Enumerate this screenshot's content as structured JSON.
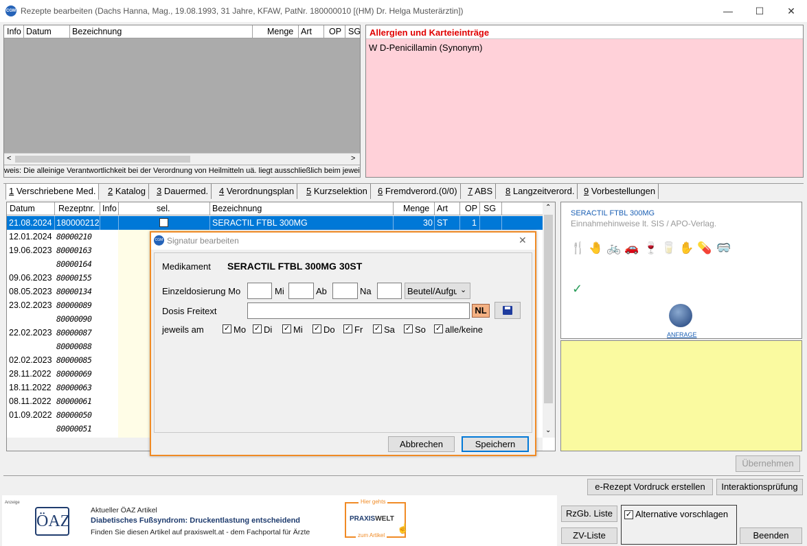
{
  "window": {
    "title": "Rezepte bearbeiten (Dachs Hanna, Mag., 19.08.1993, 31 Jahre, KFAW, PatNr. 180000010 [(HM) Dr. Helga Musterärztin])",
    "icon_text": "CGM",
    "min": "—",
    "max": "☐",
    "close": "✕"
  },
  "upper_table": {
    "headers": [
      "Info",
      "Datum",
      "Bezeichnung",
      "Menge",
      "Art",
      "OP",
      "SG"
    ],
    "hint": "weis: Die alleinige Verantwortlichkeit bei der Verordnung von Heilmitteln uä. liegt ausschließlich beim jeweiligen",
    "scroll_left": "<",
    "scroll_right": ">"
  },
  "allergy": {
    "title": "Allergien und Karteieinträge",
    "entry": "W D-Penicillamin (Synonym)"
  },
  "tabs": [
    {
      "num": "1",
      "label": " Verschriebene Med."
    },
    {
      "num": "2",
      "label": " Katalog"
    },
    {
      "num": "3",
      "label": " Dauermed."
    },
    {
      "num": "4",
      "label": " Verordnungsplan"
    },
    {
      "num": "5",
      "label": " Kurzselektion"
    },
    {
      "num": "6",
      "label": " Fremdverord.(0/0)"
    },
    {
      "num": "7",
      "label": " ABS"
    },
    {
      "num": "8",
      "label": " Langzeitverord."
    },
    {
      "num": "9",
      "label": " Vorbestellungen"
    }
  ],
  "med_table": {
    "headers": [
      "Datum",
      "Rezeptnr.",
      "Info",
      "sel.",
      "Bezeichnung",
      "Menge",
      "Art",
      "OP",
      "SG"
    ],
    "rows": [
      {
        "datum": "21.08.2024",
        "nr": "180000212",
        "bez": "SERACTIL FTBL 300MG",
        "menge": "30",
        "art": "ST",
        "op": "1"
      },
      {
        "datum": "12.01.2024",
        "nr": "80000210"
      },
      {
        "datum": "19.06.2023",
        "nr": "80000163"
      },
      {
        "datum": "",
        "nr": "80000164"
      },
      {
        "datum": "09.06.2023",
        "nr": "80000155"
      },
      {
        "datum": "08.05.2023",
        "nr": "80000134"
      },
      {
        "datum": "23.02.2023",
        "nr": "80000089"
      },
      {
        "datum": "",
        "nr": "80000090"
      },
      {
        "datum": "22.02.2023",
        "nr": "80000087"
      },
      {
        "datum": "",
        "nr": "80000088"
      },
      {
        "datum": "02.02.2023",
        "nr": "80000085"
      },
      {
        "datum": "28.11.2022",
        "nr": "80000069"
      },
      {
        "datum": "18.11.2022",
        "nr": "80000063"
      },
      {
        "datum": "08.11.2022",
        "nr": "80000061"
      },
      {
        "datum": "01.09.2022",
        "nr": "80000050"
      },
      {
        "datum": "",
        "nr": "80000051"
      }
    ]
  },
  "info_panel": {
    "drug": "SERACTIL FTBL 300MG",
    "hint": "Einnahmehinweise lt. SIS / APO-Verlag.",
    "anfrage": "ANFRAGE",
    "icons": [
      "🍴",
      "🤚",
      "🚲",
      "🚗",
      "🍷",
      "🥛",
      "✋",
      "💊",
      "🥽"
    ]
  },
  "dialog": {
    "title": "Signatur bearbeiten",
    "close": "✕",
    "medikament_label": "Medikament",
    "medikament_value": "SERACTIL FTBL 300MG 30ST",
    "einzeldosierung_label": "Einzeldosierung Mo",
    "mi": "Mi",
    "ab": "Ab",
    "na": "Na",
    "unit_select": "Beutel/Aufgu",
    "freitext_label": "Dosis Freitext",
    "nl": "NL",
    "jeweils_label": "jeweils am",
    "days": [
      "Mo",
      "Di",
      "Mi",
      "Do",
      "Fr",
      "Sa",
      "So",
      "alle/keine"
    ],
    "cancel": "Abbrechen",
    "save": "Speichern"
  },
  "buttons": {
    "uebernehmen": "Übernehmen",
    "erezept": "e-Rezept Vordruck erstellen",
    "interaktion": "Interaktionsprüfung",
    "rzgb": "RzGb. Liste",
    "zv": "ZV-Liste",
    "alternative": "Alternative vorschlagen",
    "beenden": "Beenden"
  },
  "ad": {
    "anzeige": "Anzeige",
    "logo": "ÖAZ",
    "heading": "Aktueller ÖAZ Artikel",
    "title": "Diabetisches Fußsyndrom: Druckentlastung entscheidend",
    "text": "Finden Sie diesen Artikel auf praxiswelt.at - dem Fachportal für Ärzte",
    "hier": "Hier gehts",
    "brand_a": "PRAXIS",
    "brand_b": "WELT",
    "zum": "zum Artikel"
  }
}
